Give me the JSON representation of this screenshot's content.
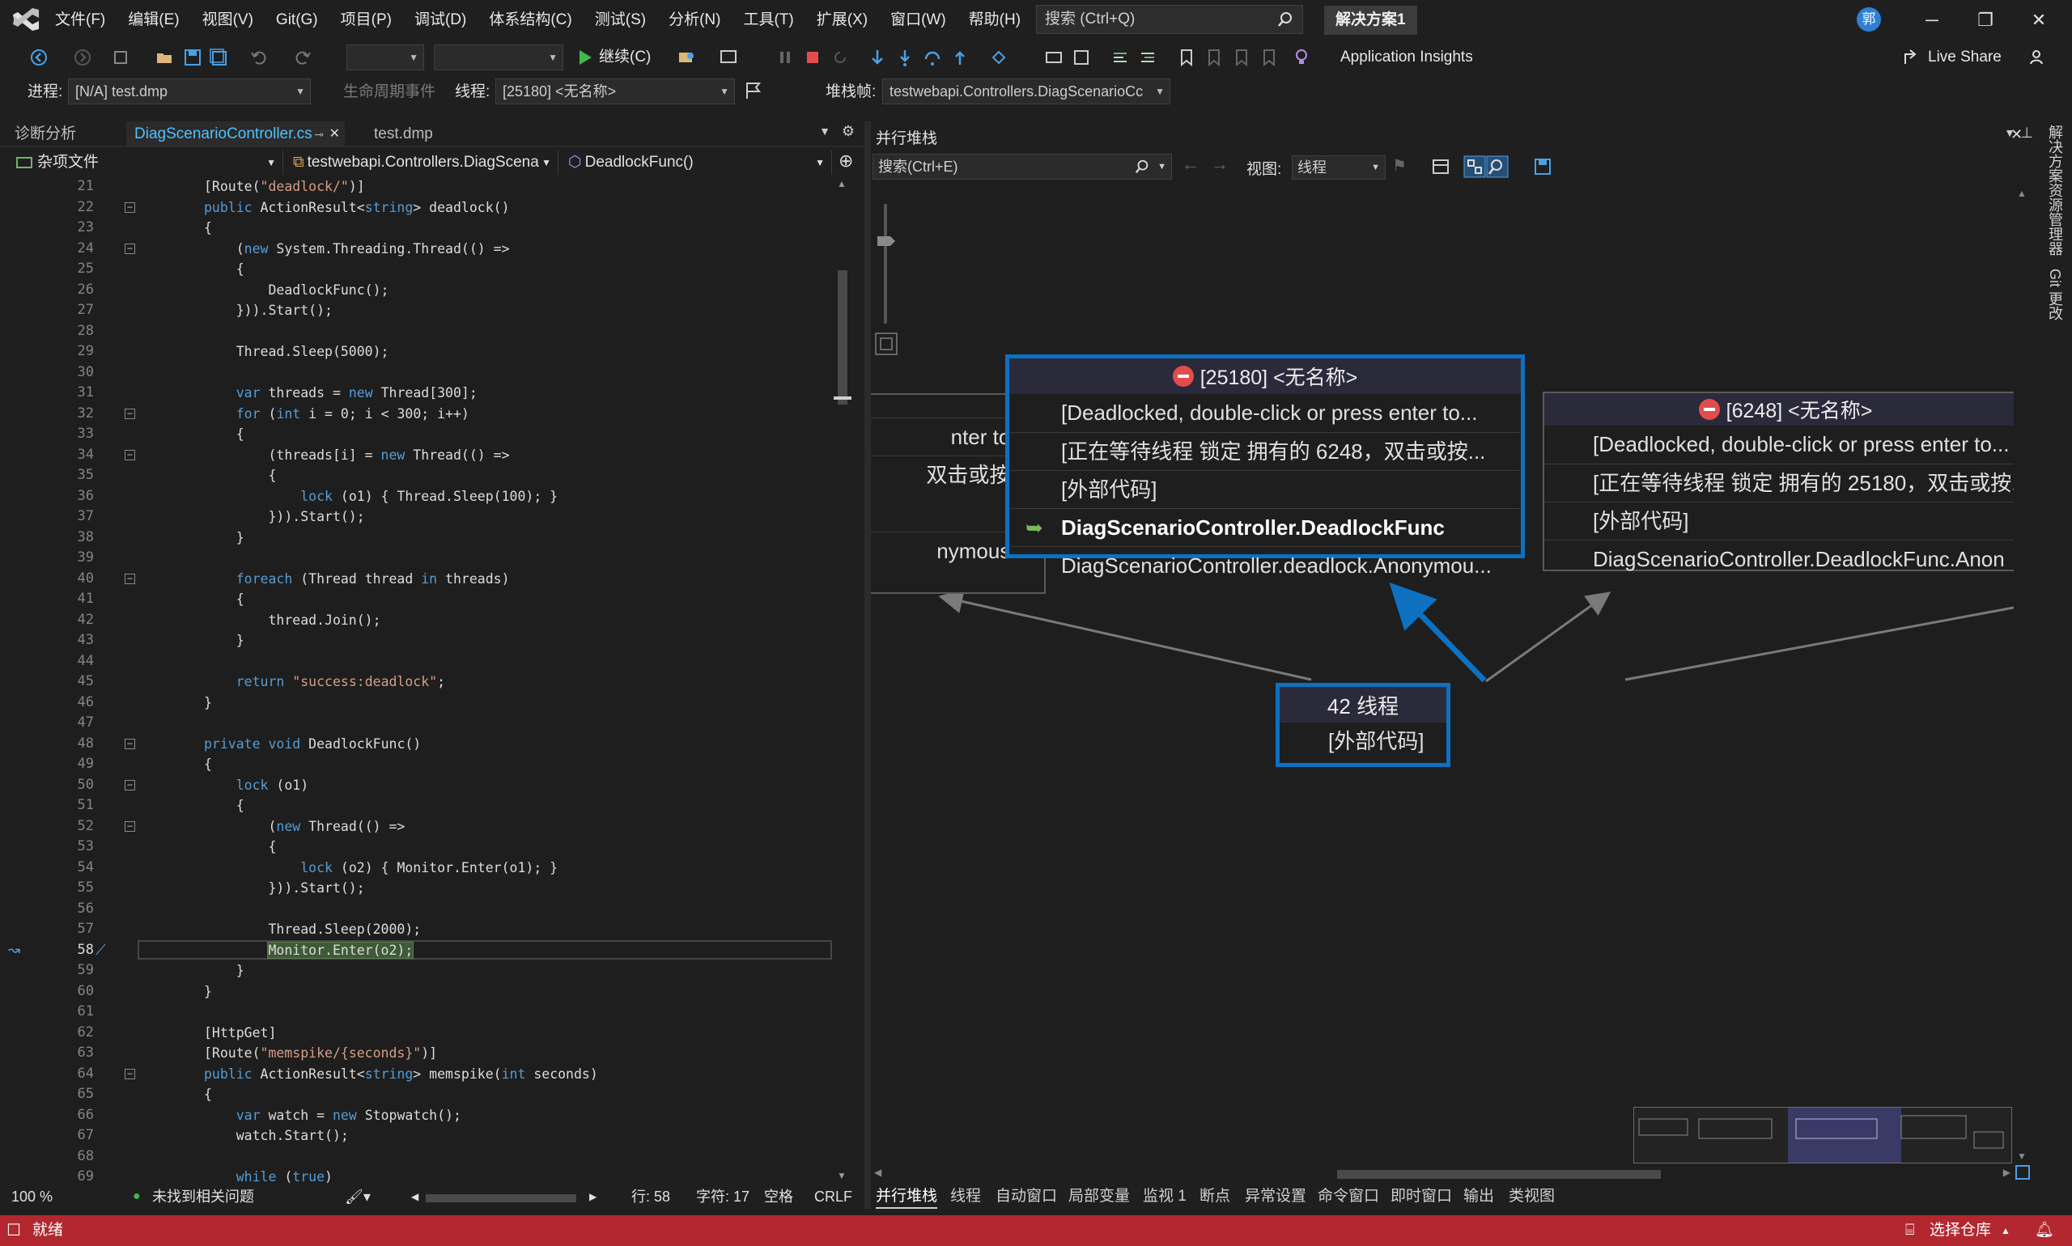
{
  "menu": [
    "文件(F)",
    "编辑(E)",
    "视图(V)",
    "Git(G)",
    "项目(P)",
    "调试(D)",
    "体系结构(C)",
    "测试(S)",
    "分析(N)",
    "工具(T)",
    "扩展(X)",
    "窗口(W)",
    "帮助(H)"
  ],
  "search": {
    "placeholder": "搜索 (Ctrl+Q)"
  },
  "solution_name": "解决方案1",
  "user_initial": "郭",
  "toolbar": {
    "continue_label": "继续(C)",
    "app_insights_label": "Application Insights",
    "live_share_label": "Live Share"
  },
  "debug_location": {
    "process_label": "进程:",
    "process_value": "[N/A] test.dmp",
    "lifecycle_label": "生命周期事件",
    "thread_label": "线程:",
    "thread_value": "[25180] <无名称>",
    "stackframe_label": "堆栈帧:",
    "stackframe_value": "testwebapi.Controllers.DiagScenarioCc"
  },
  "doc_tabs": [
    {
      "label": "诊断分析"
    },
    {
      "label": "DiagScenarioController.cs"
    },
    {
      "label": "test.dmp"
    }
  ],
  "nav": {
    "project": "杂项文件",
    "type": "testwebapi.Controllers.DiagScena",
    "member": "DeadlockFunc()"
  },
  "code": [
    {
      "n": "21",
      "t": "[Route(\"deadlock/\")]"
    },
    {
      "n": "22",
      "t": "public ActionResult<string> deadlock()"
    },
    {
      "n": "23",
      "t": "{"
    },
    {
      "n": "24",
      "t": "    (new System.Threading.Thread(() =>"
    },
    {
      "n": "25",
      "t": "    {"
    },
    {
      "n": "26",
      "t": "        DeadlockFunc();"
    },
    {
      "n": "27",
      "t": "    })).Start();"
    },
    {
      "n": "28",
      "t": ""
    },
    {
      "n": "29",
      "t": "    Thread.Sleep(5000);"
    },
    {
      "n": "30",
      "t": ""
    },
    {
      "n": "31",
      "t": "    var threads = new Thread[300];"
    },
    {
      "n": "32",
      "t": "    for (int i = 0; i < 300; i++)"
    },
    {
      "n": "33",
      "t": "    {"
    },
    {
      "n": "34",
      "t": "        (threads[i] = new Thread(() =>"
    },
    {
      "n": "35",
      "t": "        {"
    },
    {
      "n": "36",
      "t": "            lock (o1) { Thread.Sleep(100); }"
    },
    {
      "n": "37",
      "t": "        })).Start();"
    },
    {
      "n": "38",
      "t": "    }"
    },
    {
      "n": "39",
      "t": ""
    },
    {
      "n": "40",
      "t": "    foreach (Thread thread in threads)"
    },
    {
      "n": "41",
      "t": "    {"
    },
    {
      "n": "42",
      "t": "        thread.Join();"
    },
    {
      "n": "43",
      "t": "    }"
    },
    {
      "n": "44",
      "t": ""
    },
    {
      "n": "45",
      "t": "    return \"success:deadlock\";"
    },
    {
      "n": "46",
      "t": "}"
    },
    {
      "n": "47",
      "t": ""
    },
    {
      "n": "48",
      "t": "private void DeadlockFunc()"
    },
    {
      "n": "49",
      "t": "{"
    },
    {
      "n": "50",
      "t": "    lock (o1)"
    },
    {
      "n": "51",
      "t": "    {"
    },
    {
      "n": "52",
      "t": "        (new Thread(() =>"
    },
    {
      "n": "53",
      "t": "        {"
    },
    {
      "n": "54",
      "t": "            lock (o2) { Monitor.Enter(o1); }"
    },
    {
      "n": "55",
      "t": "        })).Start();"
    },
    {
      "n": "56",
      "t": ""
    },
    {
      "n": "57",
      "t": "        Thread.Sleep(2000);"
    },
    {
      "n": "58",
      "t": "        Monitor.Enter(o2);"
    },
    {
      "n": "59",
      "t": "    }"
    },
    {
      "n": "60",
      "t": "}"
    },
    {
      "n": "61",
      "t": ""
    },
    {
      "n": "62",
      "t": "[HttpGet]"
    },
    {
      "n": "63",
      "t": "[Route(\"memspike/{seconds}\")]"
    },
    {
      "n": "64",
      "t": "public ActionResult<string> memspike(int seconds)"
    },
    {
      "n": "65",
      "t": "{"
    },
    {
      "n": "66",
      "t": "    var watch = new Stopwatch();"
    },
    {
      "n": "67",
      "t": "    watch.Start();"
    },
    {
      "n": "68",
      "t": ""
    },
    {
      "n": "69",
      "t": "    while (true)"
    }
  ],
  "current_line": "58",
  "editor_status": {
    "zoom": "100 %",
    "issues": "未找到相关问题",
    "line": "行: 58",
    "char": "字符: 17",
    "spaces": "空格",
    "eol": "CRLF"
  },
  "parallel_stacks": {
    "title": "并行堆栈",
    "search_placeholder": "搜索(Ctrl+E)",
    "view_label": "视图:",
    "view_value": "线程",
    "left_card_rows": [
      "nter to...",
      "双击或按...",
      "nymous..."
    ],
    "center_card": {
      "header": "[25180]  <无名称>",
      "frames": [
        "[Deadlocked, double-click or press enter to...",
        "[正在等待线程 锁定 拥有的 6248，双击或按...",
        "[外部代码]",
        "DiagScenarioController.DeadlockFunc",
        "DiagScenarioController.deadlock.Anonymou..."
      ]
    },
    "right_card": {
      "header": "[6248]  <无名称>",
      "frames": [
        "[Deadlocked, double-click or press enter to...",
        "[正在等待线程 锁定 拥有的 25180，双击或按...",
        "[外部代码]",
        "DiagScenarioController.DeadlockFunc.Anon"
      ]
    },
    "root_card": {
      "header": "42 线程",
      "frames": [
        "[外部代码]"
      ]
    }
  },
  "bottom_tabs": [
    "并行堆栈",
    "线程",
    "自动窗口",
    "局部变量",
    "监视 1",
    "断点",
    "异常设置",
    "命令窗口",
    "即时窗口",
    "输出",
    "类视图"
  ],
  "side_tabs": [
    "解决方案资源管理器",
    "Git 更改"
  ],
  "statusbar": {
    "ready": "就绪",
    "select_repo": "选择仓库"
  },
  "colors": {
    "accent_blue": "#0e70c0",
    "status_red": "#b3272f",
    "stop_red": "#e34c4c"
  }
}
